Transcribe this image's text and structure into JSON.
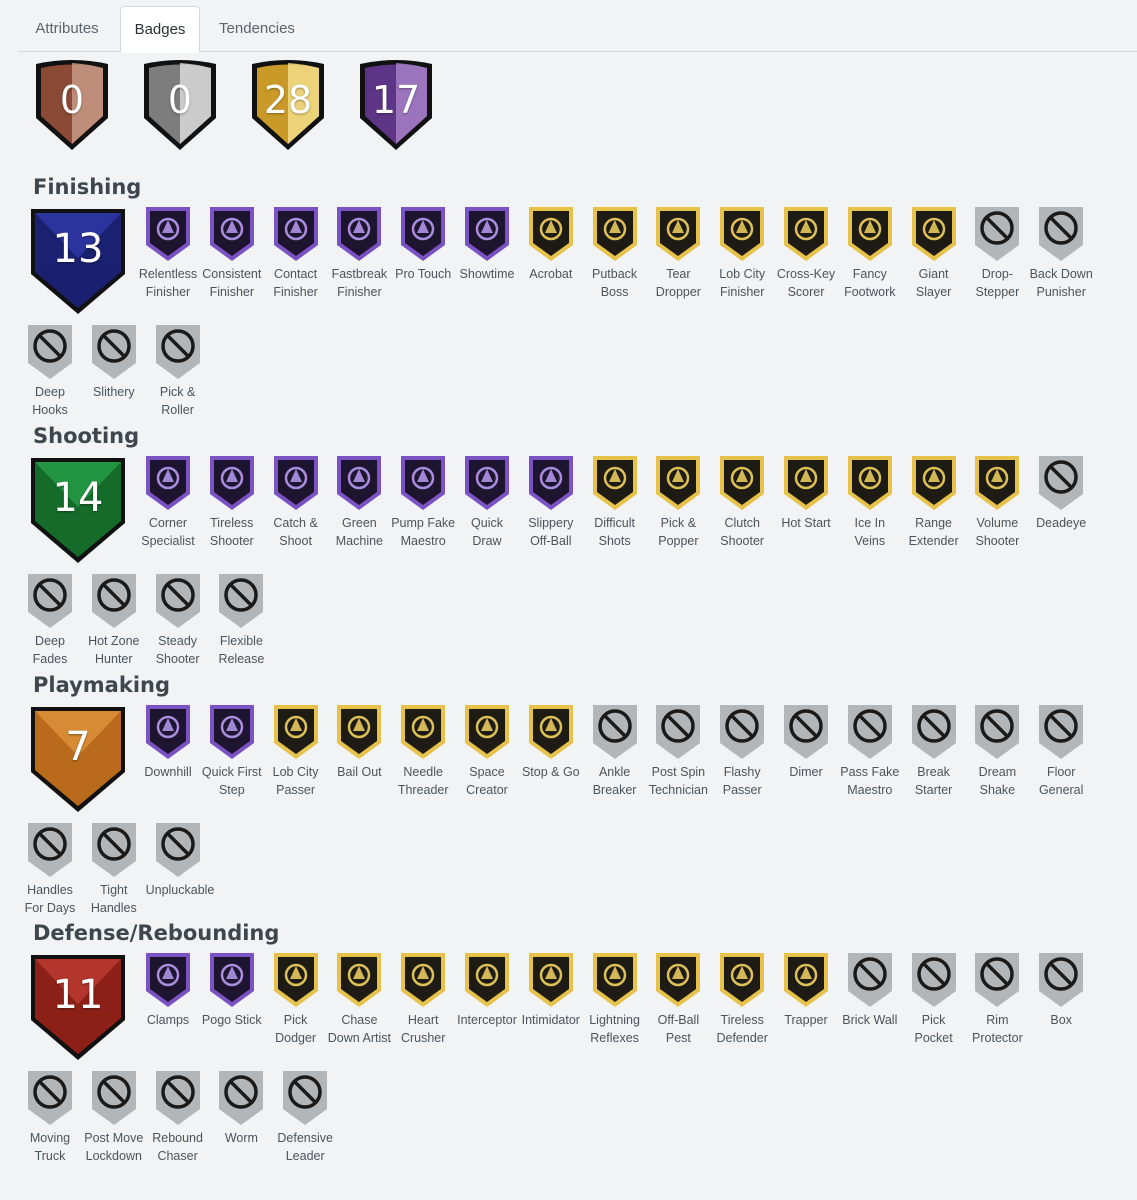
{
  "tabs": [
    "Attributes",
    "Badges",
    "Tendencies"
  ],
  "active_tab": "Badges",
  "tier_totals": [
    {
      "tier": "bronze",
      "count": "0"
    },
    {
      "tier": "silver",
      "count": "0"
    },
    {
      "tier": "gold",
      "count": "28"
    },
    {
      "tier": "hall-of-fame",
      "count": "17"
    }
  ],
  "colors": {
    "bronze": "#a0604a",
    "silver": "#9a9a9a",
    "gold": "#e3bd45",
    "hof": "#7a4fa0",
    "finishing": "#26309a",
    "shooting": "#1e8a3a",
    "playmaking": "#e08a2c",
    "defense": "#b0312a"
  },
  "sections": [
    {
      "title": "Finishing",
      "count": "13",
      "color": "finishing",
      "badges": [
        {
          "label": "Relentless Finisher",
          "tier": "hof",
          "icon": "r-logo-icon"
        },
        {
          "label": "Consistent Finisher",
          "tier": "hof",
          "icon": "stairs-icon"
        },
        {
          "label": "Contact Finisher",
          "tier": "hof",
          "icon": "impact-icon"
        },
        {
          "label": "Fastbreak Finisher",
          "tier": "hof",
          "icon": "speed-ball-icon"
        },
        {
          "label": "Pro Touch",
          "tier": "hof",
          "icon": "hand-sparkle-icon"
        },
        {
          "label": "Showtime",
          "tier": "hof",
          "icon": "stage-star-icon"
        },
        {
          "label": "Acrobat",
          "tier": "gold",
          "icon": "acrobat-icon"
        },
        {
          "label": "Putback Boss",
          "tier": "gold",
          "icon": "crown-ball-icon"
        },
        {
          "label": "Tear Dropper",
          "tier": "gold",
          "icon": "teardrop-icon"
        },
        {
          "label": "Lob City Finisher",
          "tier": "gold",
          "icon": "city-ball-icon"
        },
        {
          "label": "Cross-Key Scorer",
          "tier": "gold",
          "icon": "crossed-keys-icon"
        },
        {
          "label": "Fancy Footwork",
          "tier": "gold",
          "icon": "winged-shoe-icon"
        },
        {
          "label": "Giant Slayer",
          "tier": "gold",
          "icon": "slayer-icon"
        },
        {
          "label": "Drop-Stepper",
          "tier": "none",
          "icon": "prohibited-icon"
        },
        {
          "label": "Back Down Punisher",
          "tier": "none",
          "icon": "prohibited-icon"
        },
        {
          "label": "Deep Hooks",
          "tier": "none",
          "icon": "prohibited-icon"
        },
        {
          "label": "Slithery",
          "tier": "none",
          "icon": "prohibited-icon"
        },
        {
          "label": "Pick & Roller",
          "tier": "none",
          "icon": "prohibited-icon"
        }
      ]
    },
    {
      "title": "Shooting",
      "count": "14",
      "color": "shooting",
      "badges": [
        {
          "label": "Corner Specialist",
          "tier": "hof",
          "icon": "corner-icon"
        },
        {
          "label": "Tireless Shooter",
          "tier": "hof",
          "icon": "battery-icon"
        },
        {
          "label": "Catch & Shoot",
          "tier": "hof",
          "icon": "catch-hand-icon"
        },
        {
          "label": "Green Machine",
          "tier": "hof",
          "icon": "robot-icon"
        },
        {
          "label": "Pump Fake Maestro",
          "tier": "hof",
          "icon": "pump-icon"
        },
        {
          "label": "Quick Draw",
          "tier": "hof",
          "icon": "playbook-icon"
        },
        {
          "label": "Slippery Off-Ball",
          "tier": "hof",
          "icon": "fox-icon"
        },
        {
          "label": "Difficult Shots",
          "tier": "gold",
          "icon": "kettlebell-icon"
        },
        {
          "label": "Pick & Popper",
          "tier": "gold",
          "icon": "fist-icon"
        },
        {
          "label": "Clutch Shooter",
          "tier": "gold",
          "icon": "star-icon"
        },
        {
          "label": "Hot Start",
          "tier": "gold",
          "icon": "thermometer-icon"
        },
        {
          "label": "Ice In Veins",
          "tier": "gold",
          "icon": "ice-cubes-icon"
        },
        {
          "label": "Range Extender",
          "tier": "gold",
          "icon": "tape-measure-icon"
        },
        {
          "label": "Volume Shooter",
          "tier": "gold",
          "icon": "volume-bars-icon"
        },
        {
          "label": "Deadeye",
          "tier": "none",
          "icon": "prohibited-icon"
        },
        {
          "label": "Deep Fades",
          "tier": "none",
          "icon": "prohibited-icon"
        },
        {
          "label": "Hot Zone Hunter",
          "tier": "none",
          "icon": "prohibited-icon"
        },
        {
          "label": "Steady Shooter",
          "tier": "none",
          "icon": "prohibited-icon"
        },
        {
          "label": "Flexible Release",
          "tier": "none",
          "icon": "prohibited-icon"
        }
      ]
    },
    {
      "title": "Playmaking",
      "count": "7",
      "color": "playmaking",
      "badges": [
        {
          "label": "Downhill",
          "tier": "hof",
          "icon": "downhill-icon"
        },
        {
          "label": "Quick First Step",
          "tier": "hof",
          "icon": "quick-step-icon"
        },
        {
          "label": "Lob City Passer",
          "tier": "gold",
          "icon": "city-pass-icon"
        },
        {
          "label": "Bail Out",
          "tier": "gold",
          "icon": "money-bag-icon"
        },
        {
          "label": "Needle Threader",
          "tier": "gold",
          "icon": "needle-icon"
        },
        {
          "label": "Space Creator",
          "tier": "gold",
          "icon": "map-pin-icon"
        },
        {
          "label": "Stop & Go",
          "tier": "gold",
          "icon": "stop-sign-icon"
        },
        {
          "label": "Ankle Breaker",
          "tier": "none",
          "icon": "prohibited-icon"
        },
        {
          "label": "Post Spin Technician",
          "tier": "none",
          "icon": "prohibited-icon"
        },
        {
          "label": "Flashy Passer",
          "tier": "none",
          "icon": "prohibited-icon"
        },
        {
          "label": "Dimer",
          "tier": "none",
          "icon": "prohibited-icon"
        },
        {
          "label": "Pass Fake Maestro",
          "tier": "none",
          "icon": "prohibited-icon"
        },
        {
          "label": "Break Starter",
          "tier": "none",
          "icon": "prohibited-icon"
        },
        {
          "label": "Dream Shake",
          "tier": "none",
          "icon": "prohibited-icon"
        },
        {
          "label": "Floor General",
          "tier": "none",
          "icon": "prohibited-icon"
        },
        {
          "label": "Handles For Days",
          "tier": "none",
          "icon": "prohibited-icon"
        },
        {
          "label": "Tight Handles",
          "tier": "none",
          "icon": "prohibited-icon"
        },
        {
          "label": "Unpluckable",
          "tier": "none",
          "icon": "prohibited-icon"
        }
      ]
    },
    {
      "title": "Defense/Rebounding",
      "count": "11",
      "color": "defense",
      "badges": [
        {
          "label": "Clamps",
          "tier": "hof",
          "icon": "clamp-icon"
        },
        {
          "label": "Pogo Stick",
          "tier": "hof",
          "icon": "pogo-icon"
        },
        {
          "label": "Pick Dodger",
          "tier": "gold",
          "icon": "road-icon"
        },
        {
          "label": "Chase Down Artist",
          "tier": "gold",
          "icon": "police-badge-icon"
        },
        {
          "label": "Heart Crusher",
          "tier": "gold",
          "icon": "heart-icon"
        },
        {
          "label": "Interceptor",
          "tier": "gold",
          "icon": "jet-icon"
        },
        {
          "label": "Intimidator",
          "tier": "gold",
          "icon": "eagle-icon"
        },
        {
          "label": "Lightning Reflexes",
          "tier": "gold",
          "icon": "lightning-icon"
        },
        {
          "label": "Off-Ball Pest",
          "tier": "gold",
          "icon": "mosquito-icon"
        },
        {
          "label": "Tireless Defender",
          "tier": "gold",
          "icon": "battery-icon"
        },
        {
          "label": "Trapper",
          "tier": "gold",
          "icon": "bear-trap-icon"
        },
        {
          "label": "Brick Wall",
          "tier": "none",
          "icon": "prohibited-icon"
        },
        {
          "label": "Pick Pocket",
          "tier": "none",
          "icon": "prohibited-icon"
        },
        {
          "label": "Rim Protector",
          "tier": "none",
          "icon": "prohibited-icon"
        },
        {
          "label": "Box",
          "tier": "none",
          "icon": "prohibited-icon"
        },
        {
          "label": "Moving Truck",
          "tier": "none",
          "icon": "prohibited-icon"
        },
        {
          "label": "Post Move Lockdown",
          "tier": "none",
          "icon": "prohibited-icon"
        },
        {
          "label": "Rebound Chaser",
          "tier": "none",
          "icon": "prohibited-icon"
        },
        {
          "label": "Worm",
          "tier": "none",
          "icon": "prohibited-icon"
        },
        {
          "label": "Defensive Leader",
          "tier": "none",
          "icon": "prohibited-icon"
        }
      ]
    }
  ]
}
